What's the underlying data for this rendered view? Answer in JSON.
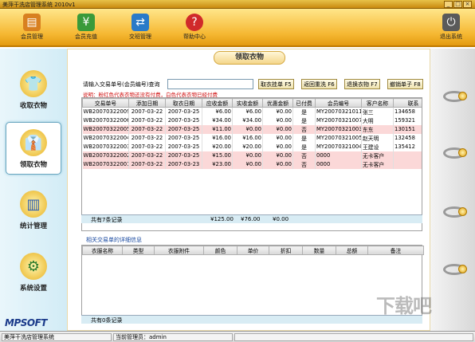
{
  "window": {
    "title": "美萍干洗店管理系统 2010v1",
    "buttons": [
      "_",
      "□",
      "×"
    ]
  },
  "toolbar": {
    "items": [
      {
        "label": "会员管理",
        "icon": "member-card-icon"
      },
      {
        "label": "会员充值",
        "icon": "recharge-icon"
      },
      {
        "label": "交班管理",
        "icon": "shift-handover-icon"
      },
      {
        "label": "帮助中心",
        "icon": "help-icon"
      }
    ],
    "exit_label": "退出系统"
  },
  "sidebar": {
    "items": [
      {
        "label": "收取衣物",
        "icon": "receive-clothes-icon"
      },
      {
        "label": "领取衣物",
        "icon": "pickup-clothes-icon",
        "active": true
      },
      {
        "label": "统计管理",
        "icon": "statistics-icon"
      },
      {
        "label": "系统设置",
        "icon": "settings-icon"
      }
    ],
    "logo": "MPSOFT"
  },
  "page": {
    "title": "领取衣物",
    "search_label": "请输入交易单号(会员编号)查询",
    "search_value": "",
    "buttons": [
      "取衣挂单 F5",
      "返回重洗 F6",
      "退换衣物 F7",
      "撤销单子 F8"
    ],
    "hint": "说明：粉红色代表衣物还没有付费，白色代表衣物已经付费"
  },
  "orders": {
    "columns": [
      "交易单号",
      "添加日期",
      "取衣日期",
      "应收金额",
      "实收金额",
      "优惠金额",
      "已付费",
      "会员编号",
      "客户名称",
      "联系"
    ],
    "rows": [
      {
        "id": "WB20070322009",
        "add": "2007-03-22",
        "pick": "2007-03-25",
        "due": "¥6.00",
        "paid": "¥6.00",
        "disc": "¥0.00",
        "ispaid": "是",
        "member": "MY20070321011",
        "name": "张三",
        "phone": "134658",
        "pink": false
      },
      {
        "id": "WB20070322006",
        "add": "2007-03-22",
        "pick": "2007-03-25",
        "due": "¥34.00",
        "paid": "¥34.00",
        "disc": "¥0.00",
        "ispaid": "是",
        "member": "MY20070321007",
        "name": "大明",
        "phone": "159321",
        "pink": false
      },
      {
        "id": "WB20070322005",
        "add": "2007-03-22",
        "pick": "2007-03-25",
        "due": "¥11.00",
        "paid": "¥0.00",
        "disc": "¥0.00",
        "ispaid": "否",
        "member": "MY20070321003",
        "name": "东东",
        "phone": "130151",
        "pink": true
      },
      {
        "id": "WB20070322004",
        "add": "2007-03-22",
        "pick": "2007-03-25",
        "due": "¥16.00",
        "paid": "¥16.00",
        "disc": "¥0.00",
        "ispaid": "是",
        "member": "MY20070321005",
        "name": "赵天明",
        "phone": "132458",
        "pink": false
      },
      {
        "id": "WB20070322003",
        "add": "2007-03-22",
        "pick": "2007-03-25",
        "due": "¥20.00",
        "paid": "¥20.00",
        "disc": "¥0.00",
        "ispaid": "是",
        "member": "MY20070321004",
        "name": "王建设",
        "phone": "135412",
        "pink": false
      },
      {
        "id": "WB20070322002",
        "add": "2007-03-22",
        "pick": "2007-03-25",
        "due": "¥15.00",
        "paid": "¥0.00",
        "disc": "¥0.00",
        "ispaid": "否",
        "member": "0000",
        "name": "无卡客户",
        "phone": "",
        "pink": true
      },
      {
        "id": "WB20070322001",
        "add": "2007-03-22",
        "pick": "2007-03-23",
        "due": "¥23.00",
        "paid": "¥0.00",
        "disc": "¥0.00",
        "ispaid": "否",
        "member": "0000",
        "name": "无卡客户",
        "phone": "",
        "pink": true
      }
    ],
    "summary": {
      "count": "共有7条记录",
      "due": "¥125.00",
      "paid": "¥76.00",
      "disc": "¥0.00"
    }
  },
  "details": {
    "label": "相关交易单的详细信息",
    "columns": [
      "衣服名称",
      "类型",
      "衣服附件",
      "颜色",
      "单价",
      "折扣",
      "数量",
      "总额",
      "备注"
    ],
    "count": "共有0条记录"
  },
  "status": {
    "app": "美萍干洗店管理系统",
    "operator": "当前管理员：admin"
  },
  "watermark": "下载吧"
}
